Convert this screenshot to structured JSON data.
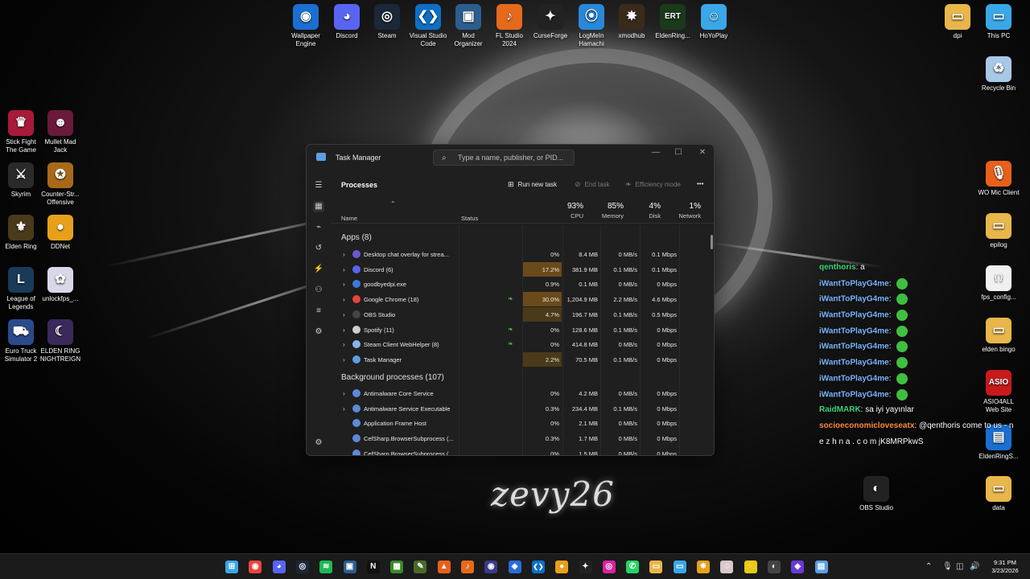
{
  "desktop": {
    "top_icons": [
      {
        "label": "Wallpaper Engine",
        "icon": "wallpaper-engine-icon",
        "color": "#1a6fd1",
        "glyph": "◉"
      },
      {
        "label": "Discord",
        "icon": "discord-icon",
        "color": "#5865f2",
        "glyph": "◕"
      },
      {
        "label": "Steam",
        "icon": "steam-icon",
        "color": "#1b2838",
        "glyph": "◎"
      },
      {
        "label": "Visual Studio Code",
        "icon": "vscode-icon",
        "color": "#0e6fc6",
        "glyph": "❮❯"
      },
      {
        "label": "Mod Organizer",
        "icon": "mod-organizer-icon",
        "color": "#2c5d8f",
        "glyph": "▣"
      },
      {
        "label": "FL Studio 2024",
        "icon": "fl-studio-icon",
        "color": "#e46a1c",
        "glyph": "♪"
      },
      {
        "label": "CurseForge",
        "icon": "curseforge-icon",
        "color": "#222222",
        "glyph": "✦"
      },
      {
        "label": "LogMeIn Hamachi",
        "icon": "hamachi-icon",
        "color": "#2a88d8",
        "glyph": "⦿"
      },
      {
        "label": "xmodhub",
        "icon": "xmodhub-icon",
        "color": "#3a2a1a",
        "glyph": "✸"
      },
      {
        "label": "EldenRing...",
        "icon": "elden-ring-tool-icon",
        "color": "#1a3a1a",
        "glyph": "ERT"
      },
      {
        "label": "HoYoPlay",
        "icon": "hoyoplay-icon",
        "color": "#3aa7e8",
        "glyph": "☺"
      }
    ],
    "left_icons": [
      {
        "label": "Stick Fight The Game",
        "icon": "stick-fight-icon",
        "color": "#a81a3a",
        "glyph": "♛"
      },
      {
        "label": "Mullet Mad Jack",
        "icon": "mullet-mad-jack-icon",
        "color": "#6a1a3a",
        "glyph": "☻"
      },
      {
        "label": "Skyrim",
        "icon": "skyrim-icon",
        "color": "#2a2a2a",
        "glyph": "⚔"
      },
      {
        "label": "Counter-Str... Offensive",
        "icon": "counter-strike-icon",
        "color": "#a86a1a",
        "glyph": "✪"
      },
      {
        "label": "Elden Ring",
        "icon": "elden-ring-icon",
        "color": "#4a3a1a",
        "glyph": "⚜"
      },
      {
        "label": "DDNet",
        "icon": "ddnet-icon",
        "color": "#e8a01a",
        "glyph": "●"
      },
      {
        "label": "League of Legends",
        "icon": "league-of-legends-icon",
        "color": "#1a3a5a",
        "glyph": "L"
      },
      {
        "label": "unlockfps_...",
        "icon": "unlockfps-icon",
        "color": "#d8d8e8",
        "glyph": "✿"
      },
      {
        "label": "Euro Truck Simulator 2",
        "icon": "euro-truck-icon",
        "color": "#2a4a8a",
        "glyph": "⛟"
      },
      {
        "label": "ELDEN RING NIGHTREIGN",
        "icon": "nightreign-icon",
        "color": "#3a2a5a",
        "glyph": "☾"
      }
    ],
    "right_icons": [
      {
        "label": "dpi",
        "icon": "folder-icon",
        "color": "#e8b64a",
        "glyph": "▭"
      },
      {
        "label": "This PC",
        "icon": "monitor-icon",
        "color": "#3aa7e8",
        "glyph": "▭"
      },
      {
        "label": "Recycle Bin",
        "icon": "recycle-bin-icon",
        "color": "#a8c8e8",
        "glyph": "♻"
      },
      {
        "label": "WO Mic Client",
        "icon": "microphone-icon",
        "color": "#e8601a",
        "glyph": "🎙"
      },
      {
        "label": "epilog",
        "icon": "folder-icon",
        "color": "#e8b64a",
        "glyph": "▭"
      },
      {
        "label": "fps_config...",
        "icon": "json-file-icon",
        "color": "#f0f0f0",
        "glyph": "{ }"
      },
      {
        "label": "elden bingo",
        "icon": "folder-icon",
        "color": "#e8b64a",
        "glyph": "▭"
      },
      {
        "label": "ASIO4ALL Web Site",
        "icon": "asio-icon",
        "color": "#c81a1a",
        "glyph": "ASIO"
      },
      {
        "label": "EldenRingS...",
        "icon": "file-icon",
        "color": "#1a6fd1",
        "glyph": "▤"
      },
      {
        "label": "OBS Studio",
        "icon": "obs-icon",
        "color": "#222222",
        "glyph": "◐"
      },
      {
        "label": "data",
        "icon": "folder-icon",
        "color": "#e8b64a",
        "glyph": "▭"
      }
    ],
    "signature": "zevy26"
  },
  "task_manager": {
    "title": "Task Manager",
    "search_placeholder": "Type a name, publisher, or PID...",
    "heading": "Processes",
    "run_new_task": "Run new task",
    "end_task": "End task",
    "efficiency_mode": "Efficiency mode",
    "more": "•••",
    "columns": {
      "name": "Name",
      "status": "Status",
      "cpu_pct": "93%",
      "cpu": "CPU",
      "mem_pct": "85%",
      "mem": "Memory",
      "disk_pct": "4%",
      "disk": "Disk",
      "net_pct": "1%",
      "net": "Network"
    },
    "apps_header": "Apps (8)",
    "apps": [
      {
        "name": "Desktop chat overlay for strea...",
        "cpu": "0%",
        "mem": "8.4 MB",
        "disk": "0 MB/s",
        "net": "0.1 Mbps",
        "icon_color": "#6a5acd",
        "icon": "overlay-icon",
        "leaf": false,
        "expand": true
      },
      {
        "name": "Discord (6)",
        "cpu": "17.2%",
        "mem": "381.9 MB",
        "disk": "0.1 MB/s",
        "net": "0.1 Mbps",
        "icon_color": "#5865f2",
        "icon": "discord-icon",
        "leaf": false,
        "expand": true
      },
      {
        "name": "goodbyedpi.exe",
        "cpu": "0.9%",
        "mem": "0.1 MB",
        "disk": "0 MB/s",
        "net": "0 Mbps",
        "icon_color": "#3a7ad8",
        "icon": "console-icon",
        "leaf": false,
        "expand": true
      },
      {
        "name": "Google Chrome (18)",
        "cpu": "30.0%",
        "mem": "1,204.9 MB",
        "disk": "2.2 MB/s",
        "net": "4.6 Mbps",
        "icon_color": "#e8453c",
        "icon": "chrome-icon",
        "leaf": true,
        "expand": true
      },
      {
        "name": "OBS Studio",
        "cpu": "4.7%",
        "mem": "196.7 MB",
        "disk": "0.1 MB/s",
        "net": "0.5 Mbps",
        "icon_color": "#444444",
        "icon": "obs-icon",
        "leaf": false,
        "expand": true
      },
      {
        "name": "Spotify (11)",
        "cpu": "0%",
        "mem": "128.6 MB",
        "disk": "0.1 MB/s",
        "net": "0 Mbps",
        "icon_color": "#cfcfcf",
        "icon": "spotify-icon",
        "leaf": true,
        "expand": true
      },
      {
        "name": "Steam Client WebHelper (8)",
        "cpu": "0%",
        "mem": "414.8 MB",
        "disk": "0 MB/s",
        "net": "0 Mbps",
        "icon_color": "#8ab4e8",
        "icon": "steam-icon",
        "leaf": true,
        "expand": true
      },
      {
        "name": "Task Manager",
        "cpu": "2.2%",
        "mem": "70.5 MB",
        "disk": "0.1 MB/s",
        "net": "0 Mbps",
        "icon_color": "#5aa0e0",
        "icon": "task-manager-icon",
        "leaf": false,
        "expand": true
      }
    ],
    "bg_header": "Background processes (107)",
    "background": [
      {
        "name": "Antimalware Core Service",
        "cpu": "0%",
        "mem": "4.2 MB",
        "disk": "0 MB/s",
        "net": "0 Mbps",
        "icon_color": "#5a8ad8",
        "icon": "service-icon",
        "expand": true
      },
      {
        "name": "Antimalware Service Executable",
        "cpu": "0.3%",
        "mem": "234.4 MB",
        "disk": "0.1 MB/s",
        "net": "0 Mbps",
        "icon_color": "#5a8ad8",
        "icon": "service-icon",
        "expand": true
      },
      {
        "name": "Application Frame Host",
        "cpu": "0%",
        "mem": "2.1 MB",
        "disk": "0 MB/s",
        "net": "0 Mbps",
        "icon_color": "#5a8ad8",
        "icon": "app-frame-icon",
        "expand": false
      },
      {
        "name": "CefSharp.BrowserSubprocess (...",
        "cpu": "0.3%",
        "mem": "1.7 MB",
        "disk": "0 MB/s",
        "net": "0 Mbps",
        "icon_color": "#5a8ad8",
        "icon": "browser-subprocess-icon",
        "expand": false
      },
      {
        "name": "CefSharp.BrowserSubprocess (...",
        "cpu": "0%",
        "mem": "1.5 MB",
        "disk": "0 MB/s",
        "net": "0 Mbps",
        "icon_color": "#5a8ad8",
        "icon": "browser-subprocess-icon",
        "expand": false
      }
    ]
  },
  "chat": [
    {
      "user": "qenthoris",
      "color": "#3fd47a",
      "text": "a",
      "emote": false
    },
    {
      "user": "iWantToPlayG4me",
      "color": "#7ab8ff",
      "text": "",
      "emote": true
    },
    {
      "user": "iWantToPlayG4me",
      "color": "#7ab8ff",
      "text": "",
      "emote": true
    },
    {
      "user": "iWantToPlayG4me",
      "color": "#7ab8ff",
      "text": "",
      "emote": true
    },
    {
      "user": "iWantToPlayG4me",
      "color": "#7ab8ff",
      "text": "",
      "emote": true
    },
    {
      "user": "iWantToPlayG4me",
      "color": "#7ab8ff",
      "text": "",
      "emote": true
    },
    {
      "user": "iWantToPlayG4me",
      "color": "#7ab8ff",
      "text": "",
      "emote": true
    },
    {
      "user": "iWantToPlayG4me",
      "color": "#7ab8ff",
      "text": "",
      "emote": true
    },
    {
      "user": "iWantToPlayG4me",
      "color": "#7ab8ff",
      "text": "",
      "emote": true
    },
    {
      "user": "RaidMARK",
      "color": "#3fd47a",
      "text": "sa iyi yayınlar",
      "emote": false
    },
    {
      "user": "socioeconomicloveseatx",
      "color": "#ff8c3a",
      "text": "@qenthoris come to us - n",
      "emote": false
    },
    {
      "user": "",
      "color": "#ffffff",
      "text": "e z h n a . c o m jK8MRPkwS",
      "emote": false
    }
  ],
  "taskbar": {
    "items": [
      {
        "icon": "windows-start-icon",
        "color": "#3aa7e8",
        "glyph": "⊞"
      },
      {
        "icon": "chrome-icon",
        "color": "#e8453c",
        "glyph": "◉"
      },
      {
        "icon": "discord-icon",
        "color": "#5865f2",
        "glyph": "◕"
      },
      {
        "icon": "steam-icon",
        "color": "#1b2838",
        "glyph": "◎"
      },
      {
        "icon": "spotify-icon",
        "color": "#1db954",
        "glyph": "≋"
      },
      {
        "icon": "mod-organizer-icon",
        "color": "#2c5d8f",
        "glyph": "▣"
      },
      {
        "icon": "netflix-icon",
        "color": "#111111",
        "glyph": "N"
      },
      {
        "icon": "minecraft-icon",
        "color": "#3a8a2a",
        "glyph": "▦"
      },
      {
        "icon": "notepad-icon",
        "color": "#4a6a2a",
        "glyph": "✎"
      },
      {
        "icon": "brave-icon",
        "color": "#e8601a",
        "glyph": "▲"
      },
      {
        "icon": "fl-studio-icon",
        "color": "#e46a1c",
        "glyph": "♪"
      },
      {
        "icon": "wallpaper-engine-icon",
        "color": "#3a3a8a",
        "glyph": "◉"
      },
      {
        "icon": "visual-studio-icon",
        "color": "#2a6ad8",
        "glyph": "◈"
      },
      {
        "icon": "vscode-icon",
        "color": "#0e6fc6",
        "glyph": "❮❯"
      },
      {
        "icon": "ddnet-icon",
        "color": "#e8a01a",
        "glyph": "●"
      },
      {
        "icon": "curseforge-icon",
        "color": "#222222",
        "glyph": "✦"
      },
      {
        "icon": "instagram-icon",
        "color": "#d6249f",
        "glyph": "◎"
      },
      {
        "icon": "whatsapp-icon",
        "color": "#25d366",
        "glyph": "✆"
      },
      {
        "icon": "file-explorer-icon",
        "color": "#e8b64a",
        "glyph": "▭"
      },
      {
        "icon": "remote-desktop-icon",
        "color": "#3aa7e8",
        "glyph": "▭"
      },
      {
        "icon": "xmodhub-icon",
        "color": "#e8a01a",
        "glyph": "✸"
      },
      {
        "icon": "anime-app-icon",
        "color": "#d8c8c8",
        "glyph": "☺"
      },
      {
        "icon": "valorant-icon",
        "color": "#e8c81a",
        "glyph": "⚡"
      },
      {
        "icon": "obs-icon",
        "color": "#444444",
        "glyph": "◐"
      },
      {
        "icon": "purple-app-icon",
        "color": "#6a3ad8",
        "glyph": "◆"
      },
      {
        "icon": "task-manager-icon",
        "color": "#5aa0e0",
        "glyph": "▤"
      }
    ],
    "clock_time": "9:31 PM",
    "clock_date": "3/23/2026"
  }
}
